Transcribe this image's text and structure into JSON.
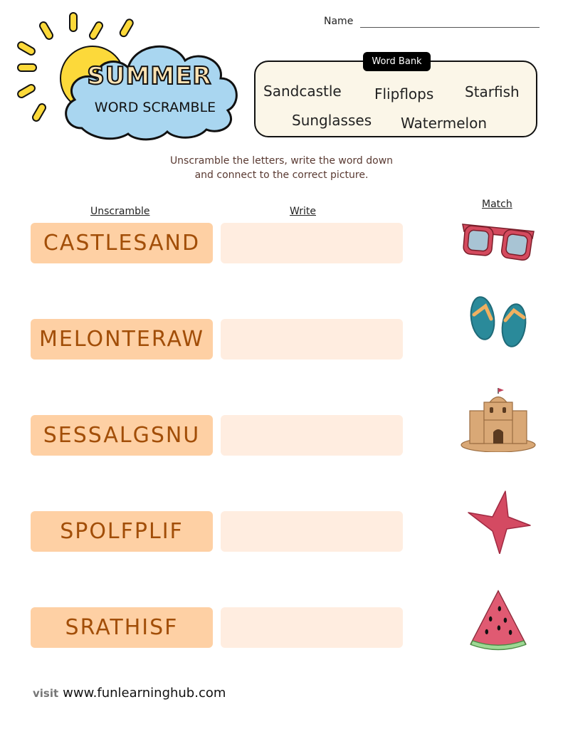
{
  "header": {
    "name_label": "Name",
    "title_top": "SUMMER",
    "title_bottom": "WORD SCRAMBLE"
  },
  "word_bank": {
    "title": "Word Bank",
    "words": [
      "Sandcastle",
      "Flipflops",
      "Starfish",
      "Sunglasses",
      "Watermelon"
    ]
  },
  "instructions": {
    "line1": "Unscramble the letters, write the word down",
    "line2": "and connect to the correct picture."
  },
  "columns": {
    "unscramble": "Unscramble",
    "write": "Write",
    "match": "Match"
  },
  "rows": [
    {
      "scrambled": "CASTLESAND",
      "written": "",
      "picture": "sunglasses-icon"
    },
    {
      "scrambled": "MELONTERAW",
      "written": "",
      "picture": "flipflops-icon"
    },
    {
      "scrambled": "SESSALGSNU",
      "written": "",
      "picture": "sandcastle-icon"
    },
    {
      "scrambled": "SPOLFPLIF",
      "written": "",
      "picture": "starfish-icon"
    },
    {
      "scrambled": "SRATHISF",
      "written": "",
      "picture": "watermelon-icon"
    }
  ],
  "footer": {
    "visit": "visit",
    "url": "www.funlearninghub.com"
  },
  "colors": {
    "scramble_box": "#fed0a4",
    "scramble_text": "#a24e08",
    "write_box": "#ffede0",
    "word_bank_bg": "#fbf6e8"
  }
}
